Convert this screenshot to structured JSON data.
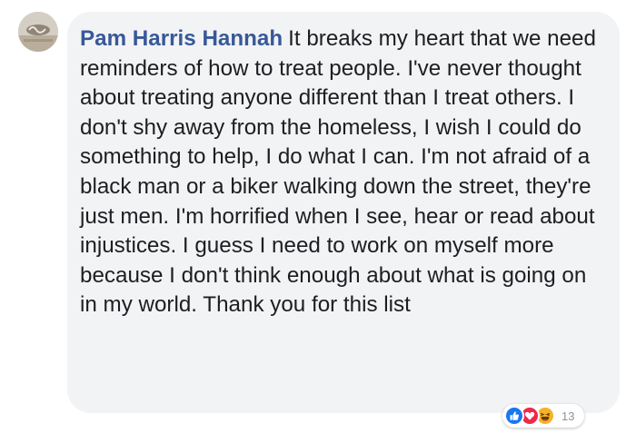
{
  "comment": {
    "author": "Pam Harris Hannah",
    "text": "It breaks my heart that we need reminders of how to treat people. I've never thought about treating anyone different than I treat others. I don't shy away from the homeless, I wish I could do something to help, I do what I can. I'm not afraid of a black man or a biker walking down the street, they're just men. I'm horrified when I see, hear or read about injustices. I guess I need to work on myself more because I don't think enough about what is going on in my world. Thank you for this list"
  },
  "reactions": {
    "icons": [
      "like-icon",
      "love-icon",
      "haha-icon"
    ],
    "count": "13"
  },
  "colors": {
    "author_link": "#385898",
    "bubble_bg": "#f2f3f5",
    "text": "#1c1e21",
    "like": "#1877f2",
    "love": "#f0284a",
    "haha": "#f7b125",
    "count": "#8d949e"
  }
}
